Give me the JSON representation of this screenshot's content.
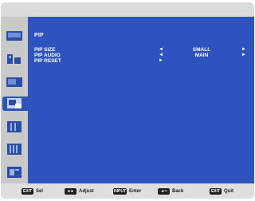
{
  "menu": {
    "title": "PIP",
    "rows": [
      {
        "label": "PIP SIZE",
        "left_arrow": "◄",
        "value": "SMALL",
        "right_arrow": "►"
      },
      {
        "label": "PIP AUDIO",
        "left_arrow": "◄",
        "value": "MAIN",
        "right_arrow": "►"
      },
      {
        "label": "PIP RESET",
        "left_arrow": "►",
        "value": "",
        "right_arrow": ""
      }
    ]
  },
  "sidebar": {
    "items": [
      {
        "icon": "picture-icon"
      },
      {
        "icon": "audio-icon"
      },
      {
        "icon": "schedule-icon"
      },
      {
        "icon": "pip-icon",
        "active": true
      },
      {
        "icon": "display-icon"
      },
      {
        "icon": "advanced-icon"
      },
      {
        "icon": "info-icon"
      }
    ]
  },
  "footer": {
    "keys": [
      {
        "key": "EXIT",
        "label": "Sel"
      },
      {
        "key": "◄►",
        "label": "Adjust"
      },
      {
        "key": "INPUT",
        "label": "Enter"
      },
      {
        "key": "◄═",
        "label": "Back"
      },
      {
        "key": "EXIT",
        "label": "Quit"
      }
    ]
  },
  "colors": {
    "menu_background": "#2e52be",
    "sidebar_background": "#c9c9c9",
    "active_tab": "#2d52b8",
    "text": "#ffffff"
  }
}
